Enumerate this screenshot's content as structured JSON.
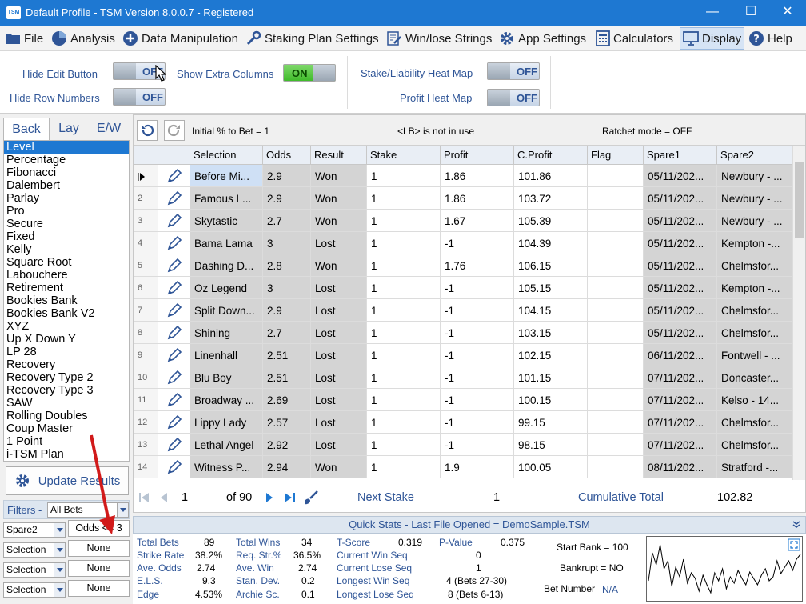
{
  "titlebar": {
    "logo_text": "TSM",
    "title": "Default Profile  - TSM Version 8.0.0.7 - Registered",
    "minimize": "—",
    "maximize": "☐",
    "close": "✕"
  },
  "menu": [
    {
      "label": "File",
      "icon": "folder-icon"
    },
    {
      "label": "Analysis",
      "icon": "pie-chart-icon"
    },
    {
      "label": "Data Manipulation",
      "icon": "plus-circle-icon"
    },
    {
      "label": "Staking Plan Settings",
      "icon": "wrench-icon"
    },
    {
      "label": "Win/lose Strings",
      "icon": "document-edit-icon"
    },
    {
      "label": "App Settings",
      "icon": "gear-icon"
    },
    {
      "label": "Calculators",
      "icon": "calculator-icon"
    },
    {
      "label": "Display",
      "icon": "monitor-icon"
    },
    {
      "label": "Help",
      "icon": "help-icon"
    }
  ],
  "ribbon": {
    "hide_edit_button": {
      "label": "Hide Edit Button",
      "state": "OFF"
    },
    "hide_row_numbers": {
      "label": "Hide Row Numbers",
      "state": "OFF"
    },
    "show_extra_columns": {
      "label": "Show Extra Columns",
      "state": "ON"
    },
    "stake_heat_map": {
      "label": "Stake/Liability Heat Map",
      "state": "OFF"
    },
    "profit_heat_map": {
      "label": "Profit Heat Map",
      "state": "OFF"
    }
  },
  "left": {
    "tabs": [
      "Back",
      "Lay",
      "E/W"
    ],
    "plans": [
      "Level",
      "Percentage",
      "Fibonacci",
      "Dalembert",
      "Parlay",
      "Pro",
      "Secure",
      "Fixed",
      "Kelly",
      "Square Root",
      "Labouchere",
      "Retirement",
      "Bookies Bank",
      "Bookies Bank V2",
      "XYZ",
      "Up X Down Y",
      "LP 28",
      "Recovery",
      "Recovery Type 2",
      "Recovery Type 3",
      "SAW",
      "Rolling Doubles",
      "Coup Master",
      "1 Point",
      "i-TSM Plan"
    ],
    "update_button": "Update Results",
    "filters_label": "Filters -",
    "filters_value": "All Bets",
    "filter_rows": [
      {
        "field": "Spare2",
        "value": "Odds <= 3"
      },
      {
        "field": "Selection",
        "value": "None"
      },
      {
        "field": "Selection",
        "value": "None"
      },
      {
        "field": "Selection",
        "value": "None"
      }
    ]
  },
  "toolbar": {
    "initial_pct": "Initial % to Bet = 1",
    "lb": "<LB> is not in use",
    "ratchet": "Ratchet mode = OFF"
  },
  "grid": {
    "columns": [
      "Selection",
      "Odds",
      "Result",
      "Stake",
      "Profit",
      "C.Profit",
      "Flag",
      "Spare1",
      "Spare2"
    ],
    "rows": [
      {
        "n": "1",
        "selection": "Before Mi...",
        "odds": "2.9",
        "result": "Won",
        "stake": "1",
        "profit": "1.86",
        "cprofit": "101.86",
        "flag": "",
        "spare1": "05/11/202...",
        "spare2": "Newbury - ..."
      },
      {
        "n": "2",
        "selection": "Famous L...",
        "odds": "2.9",
        "result": "Won",
        "stake": "1",
        "profit": "1.86",
        "cprofit": "103.72",
        "flag": "",
        "spare1": "05/11/202...",
        "spare2": "Newbury - ..."
      },
      {
        "n": "3",
        "selection": "Skytastic",
        "odds": "2.7",
        "result": "Won",
        "stake": "1",
        "profit": "1.67",
        "cprofit": "105.39",
        "flag": "",
        "spare1": "05/11/202...",
        "spare2": "Newbury - ..."
      },
      {
        "n": "4",
        "selection": "Bama Lama",
        "odds": "3",
        "result": "Lost",
        "stake": "1",
        "profit": "-1",
        "cprofit": "104.39",
        "flag": "",
        "spare1": "05/11/202...",
        "spare2": "Kempton -..."
      },
      {
        "n": "5",
        "selection": "Dashing D...",
        "odds": "2.8",
        "result": "Won",
        "stake": "1",
        "profit": "1.76",
        "cprofit": "106.15",
        "flag": "",
        "spare1": "05/11/202...",
        "spare2": "Chelmsfor..."
      },
      {
        "n": "6",
        "selection": "Oz Legend",
        "odds": "3",
        "result": "Lost",
        "stake": "1",
        "profit": "-1",
        "cprofit": "105.15",
        "flag": "",
        "spare1": "05/11/202...",
        "spare2": "Kempton -..."
      },
      {
        "n": "7",
        "selection": "Split Down...",
        "odds": "2.9",
        "result": "Lost",
        "stake": "1",
        "profit": "-1",
        "cprofit": "104.15",
        "flag": "",
        "spare1": "05/11/202...",
        "spare2": "Chelmsfor..."
      },
      {
        "n": "8",
        "selection": "Shining",
        "odds": "2.7",
        "result": "Lost",
        "stake": "1",
        "profit": "-1",
        "cprofit": "103.15",
        "flag": "",
        "spare1": "05/11/202...",
        "spare2": "Chelmsfor..."
      },
      {
        "n": "9",
        "selection": "Linenhall",
        "odds": "2.51",
        "result": "Lost",
        "stake": "1",
        "profit": "-1",
        "cprofit": "102.15",
        "flag": "",
        "spare1": "06/11/202...",
        "spare2": "Fontwell - ..."
      },
      {
        "n": "10",
        "selection": "Blu Boy",
        "odds": "2.51",
        "result": "Lost",
        "stake": "1",
        "profit": "-1",
        "cprofit": "101.15",
        "flag": "",
        "spare1": "07/11/202...",
        "spare2": "Doncaster..."
      },
      {
        "n": "11",
        "selection": "Broadway ...",
        "odds": "2.69",
        "result": "Lost",
        "stake": "1",
        "profit": "-1",
        "cprofit": "100.15",
        "flag": "",
        "spare1": "07/11/202...",
        "spare2": "Kelso - 14..."
      },
      {
        "n": "12",
        "selection": "Lippy Lady",
        "odds": "2.57",
        "result": "Lost",
        "stake": "1",
        "profit": "-1",
        "cprofit": "99.15",
        "flag": "",
        "spare1": "07/11/202...",
        "spare2": "Chelmsfor..."
      },
      {
        "n": "13",
        "selection": "Lethal Angel",
        "odds": "2.92",
        "result": "Lost",
        "stake": "1",
        "profit": "-1",
        "cprofit": "98.15",
        "flag": "",
        "spare1": "07/11/202...",
        "spare2": "Chelmsfor..."
      },
      {
        "n": "14",
        "selection": "Witness P...",
        "odds": "2.94",
        "result": "Won",
        "stake": "1",
        "profit": "1.9",
        "cprofit": "100.05",
        "flag": "",
        "spare1": "08/11/202...",
        "spare2": "Stratford -..."
      }
    ]
  },
  "nav": {
    "record": "1",
    "of_total": "of 90",
    "next_stake_label": "Next Stake",
    "next_stake_value": "1",
    "cumulative_label": "Cumulative Total",
    "cumulative_value": "102.82"
  },
  "quickstats": {
    "header": "Quick Stats - Last File Opened = DemoSample.TSM",
    "col1": [
      {
        "label": "Total Bets",
        "value": "89"
      },
      {
        "label": "Strike Rate",
        "value": "38.2%"
      },
      {
        "label": "Ave. Odds",
        "value": "2.74"
      },
      {
        "label": "E.L.S.",
        "value": "9.3"
      },
      {
        "label": "Edge",
        "value": "4.53%"
      }
    ],
    "col2": [
      {
        "label": "Total Wins",
        "value": "34"
      },
      {
        "label": "Req. Str.%",
        "value": "36.5%"
      },
      {
        "label": "Ave. Win",
        "value": "2.74"
      },
      {
        "label": "Stan. Dev.",
        "value": "0.2"
      },
      {
        "label": "Archie Sc.",
        "value": "0.1"
      }
    ],
    "tscore": {
      "label": "T-Score",
      "value": "0.319"
    },
    "pvalue": {
      "label": "P-Value",
      "value": "0.375"
    },
    "current_win": {
      "label": "Current Win Seq",
      "value": "0"
    },
    "current_lose": {
      "label": "Current Lose Seq",
      "value": "1"
    },
    "longest_win": {
      "label": "Longest Win Seq",
      "value": "4  (Bets 27-30)"
    },
    "longest_lose": {
      "label": "Longest Lose Seq",
      "value": "8  (Bets 6-13)"
    },
    "start_bank": "Start Bank = 100",
    "bankrupt": "Bankrupt = NO",
    "bet_number_label": "Bet Number",
    "bet_number_value": "N/A"
  },
  "colors": {
    "accent": "#1e78d2",
    "label_blue": "#2f5597",
    "annotation_red": "#d11a1a"
  }
}
